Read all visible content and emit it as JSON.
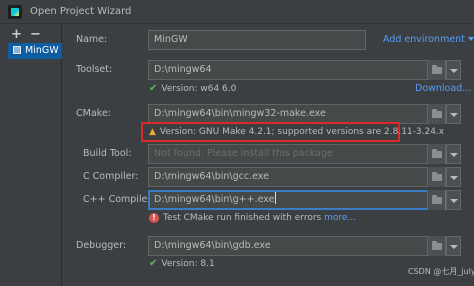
{
  "window": {
    "title": "Open Project Wizard"
  },
  "toolbar": {
    "add": "+",
    "remove": "−"
  },
  "sidebar": {
    "items": [
      {
        "label": "MinGW"
      }
    ]
  },
  "form": {
    "name": {
      "label": "Name:",
      "value": "MinGW",
      "add_env": "Add environment"
    },
    "toolset": {
      "label": "Toolset:",
      "value": "D:\\mingw64",
      "version": "Version: w64 6.0",
      "download": "Download..."
    },
    "cmake": {
      "label": "CMake:",
      "value": "D:\\mingw64\\bin\\mingw32-make.exe",
      "warning": "Version: GNU Make 4.2.1; supported versions are 2.8.11-3.24.x"
    },
    "build_tool": {
      "label": "Build Tool:",
      "placeholder": "Not found. Please install this package"
    },
    "c_compiler": {
      "label": "C Compiler:",
      "value": "D:\\mingw64\\bin\\gcc.exe"
    },
    "cpp_compiler": {
      "label": "C++ Compiler:",
      "value": "D:\\mingw64\\bin\\g++.exe",
      "error_text": "Test CMake run finished with errors",
      "more": "more..."
    },
    "debugger": {
      "label": "Debugger:",
      "value": "D:\\mingw64\\bin\\gdb.exe",
      "version": "Version: 8.1"
    }
  },
  "watermark": "CSDN @七月_july",
  "colors": {
    "accent": "#589df6",
    "selection": "#0d5da0",
    "warning": "#f0a732",
    "error": "#d9534f",
    "ok": "#5fb760",
    "highlight": "#d92a2a"
  },
  "icons": {
    "app": "clion-logo-icon",
    "folder": "folder-icon",
    "dropdown": "chevron-down-icon",
    "check": "check-icon",
    "warn": "warning-icon",
    "err": "error-icon"
  }
}
